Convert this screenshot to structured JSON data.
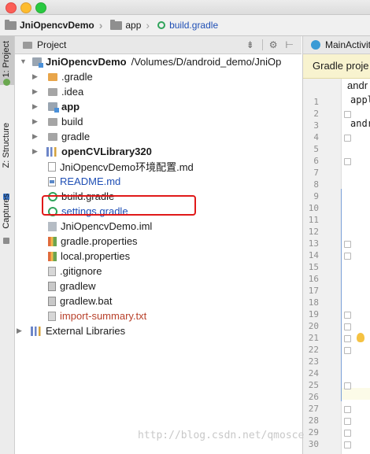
{
  "breadcrumbs": [
    {
      "label": "JniOpencvDemo"
    },
    {
      "label": "app"
    },
    {
      "label": "build.gradle"
    }
  ],
  "side_tabs": {
    "project": "1: Project",
    "structure": "Z: Structure",
    "captures": "Captures"
  },
  "panel": {
    "title": "Project"
  },
  "tree": {
    "root_name": "JniOpencvDemo",
    "root_path": "/Volumes/D/android_demo/JniOp",
    "items": [
      {
        "label": ".gradle"
      },
      {
        "label": ".idea"
      },
      {
        "label": "app"
      },
      {
        "label": "build"
      },
      {
        "label": "gradle"
      },
      {
        "label": "openCVLibrary320"
      },
      {
        "label": "JniOpencvDemo环境配置.md"
      },
      {
        "label": "README.md"
      },
      {
        "label": "build.gradle"
      },
      {
        "label": "settings.gradle"
      },
      {
        "label": "JniOpencvDemo.iml"
      },
      {
        "label": "gradle.properties"
      },
      {
        "label": "local.properties"
      },
      {
        "label": ".gitignore"
      },
      {
        "label": "gradlew"
      },
      {
        "label": "gradlew.bat"
      },
      {
        "label": "import-summary.txt"
      }
    ],
    "external": "External Libraries"
  },
  "editor": {
    "tab": "MainActivit",
    "banner": "Gradle proje",
    "banner_button": "andr",
    "code_lines": [
      "appl",
      "andr"
    ],
    "line_numbers": [
      "1",
      "2",
      "3",
      "4",
      "5",
      "6",
      "7",
      "8",
      "9",
      "10",
      "11",
      "12",
      "13",
      "14",
      "15",
      "16",
      "17",
      "18",
      "19",
      "20",
      "21",
      "22",
      "23",
      "24",
      "25",
      "26",
      "27",
      "28",
      "29",
      "30"
    ]
  },
  "watermark": "http://blog.csdn.net/qmosce",
  "colors": {
    "highlight_box": "#e01919",
    "accent_blue": "#1f4fb5",
    "gradle_green": "#2fa35a"
  }
}
